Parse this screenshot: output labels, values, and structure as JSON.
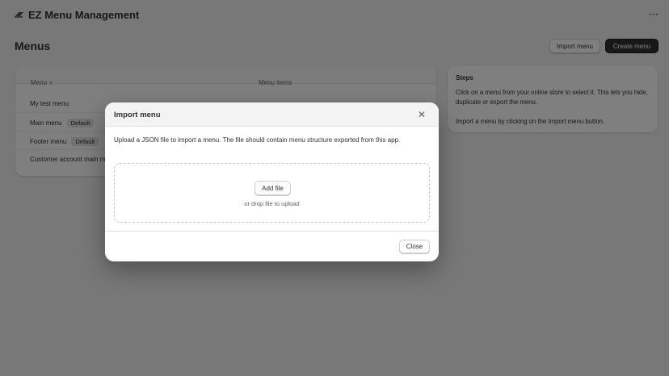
{
  "app": {
    "title": "EZ Menu Management",
    "logo_icon": "ez-logo-icon",
    "more_icon": "more-horizontal-icon"
  },
  "page": {
    "title": "Menus",
    "import_button": "Import menu",
    "create_button": "Create menu"
  },
  "menus_table": {
    "columns": [
      "Menu",
      "Menu items"
    ],
    "sort_icon": "sort-icon",
    "rows": [
      {
        "name": "My test menu",
        "badge": ""
      },
      {
        "name": "Main menu",
        "badge": "Default"
      },
      {
        "name": "Footer menu",
        "badge": "Default"
      },
      {
        "name": "Customer account main menu",
        "badge": ""
      }
    ]
  },
  "steps": {
    "title": "Steps",
    "paragraph_1": "Click on a menu from your online store to select it. This lets you hide, duplicate or export the menu.",
    "paragraph_2": "Import a menu by clicking on the Import menu button."
  },
  "modal": {
    "title": "Import menu",
    "description": "Upload a JSON file to import a menu. The file should contain menu structure exported from this app.",
    "add_file_button": "Add file",
    "drop_hint": "or drop file to upload",
    "close_button": "Close",
    "close_icon": "close-icon"
  },
  "colors": {
    "page_bg": "#f1f1f1",
    "primary_button": "#303030",
    "overlay": "rgba(0,0,0,0.5)"
  }
}
